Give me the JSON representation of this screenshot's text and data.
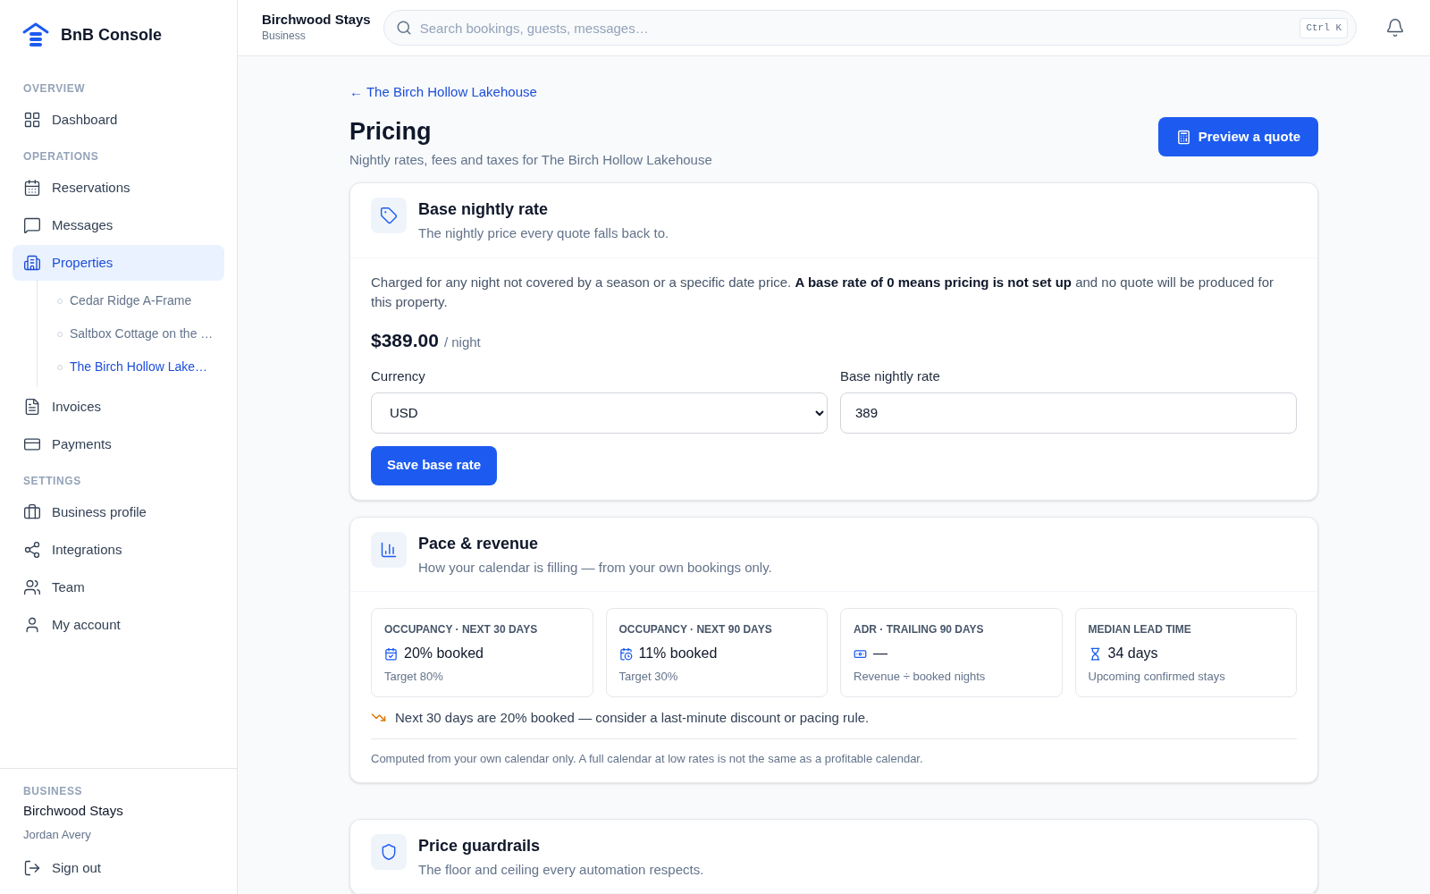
{
  "brand": {
    "name": "BnB Console"
  },
  "sidebar": {
    "sections": [
      {
        "heading": "OVERVIEW",
        "items": [
          {
            "label": "Dashboard",
            "selected": false
          }
        ]
      },
      {
        "heading": "OPERATIONS",
        "items": [
          {
            "label": "Reservations",
            "selected": false
          },
          {
            "label": "Messages",
            "selected": false
          },
          {
            "label": "Properties",
            "selected": true,
            "children": [
              {
                "label": "Cedar Ridge A-Frame",
                "selected": false
              },
              {
                "label": "Saltbox Cottage on the …",
                "selected": false
              },
              {
                "label": "The Birch Hollow Lake…",
                "selected": true
              }
            ]
          },
          {
            "label": "Invoices",
            "selected": false
          },
          {
            "label": "Payments",
            "selected": false
          }
        ]
      },
      {
        "heading": "SETTINGS",
        "items": [
          {
            "label": "Business profile",
            "selected": false
          },
          {
            "label": "Integrations",
            "selected": false
          },
          {
            "label": "Team",
            "selected": false
          },
          {
            "label": "My account",
            "selected": false
          }
        ]
      }
    ],
    "footer": {
      "heading": "BUSINESS",
      "business": "Birchwood Stays",
      "user": "Jordan Avery",
      "sign_out": "Sign out"
    }
  },
  "header": {
    "business": "Birchwood Stays",
    "subtitle": "Business",
    "search": {
      "placeholder": "Search bookings, guests, messages…",
      "shortcut": "Ctrl K"
    }
  },
  "page": {
    "back_link": "← The Birch Hollow Lakehouse",
    "title": "Pricing",
    "subtitle": "Nightly rates, fees and taxes for The Birch Hollow Lakehouse",
    "action": "Preview a quote"
  },
  "base_rate": {
    "title": "Base nightly rate",
    "subtitle": "The nightly price every quote falls back to.",
    "description": "Charged for any night not covered by a season or a specific date price. **A base rate of 0 means pricing is not set up** and no quote will be produced for this property.",
    "price": "$389.00",
    "unit": "/ night",
    "currency": {
      "label": "Currency",
      "value": "USD"
    },
    "rate": {
      "label": "Base nightly rate",
      "value": "389"
    },
    "save": "Save base rate"
  },
  "pace": {
    "title": "Pace & revenue",
    "subtitle": "How your calendar is filling — from your own bookings only.",
    "metrics": [
      {
        "label": "OCCUPANCY · NEXT 30 DAYS",
        "value": "20% booked",
        "note": "Target 80%"
      },
      {
        "label": "OCCUPANCY · NEXT 90 DAYS",
        "value": "11% booked",
        "note": "Target 30%"
      },
      {
        "label": "ADR · TRAILING 90 DAYS",
        "value": "—",
        "note": "Revenue ÷ booked nights"
      },
      {
        "label": "MEDIAN LEAD TIME",
        "value": "34 days",
        "note": "Upcoming confirmed stays"
      }
    ],
    "alert": "Next 30 days are 20% booked — consider a last-minute discount or pacing rule.",
    "footnote": "Computed from your own calendar only. A full calendar at low rates is not the same as a profitable calendar."
  },
  "guardrails": {
    "title": "Price guardrails",
    "subtitle": "The floor and ceiling every automation respects."
  }
}
